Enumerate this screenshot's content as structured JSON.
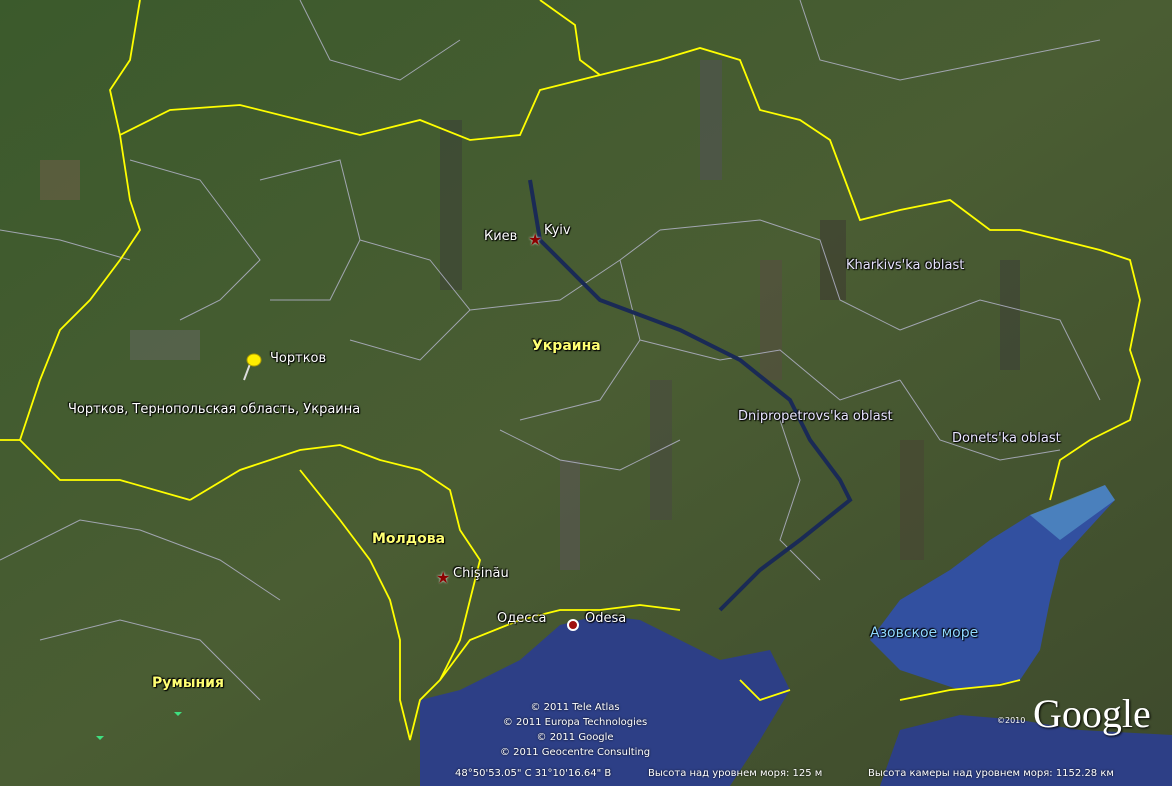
{
  "places": {
    "kyiv_ru": "Киев",
    "kyiv_en": "Kyiv",
    "chortkov": "Чортков",
    "chortkov_full": "Чортков, Тернопольская область, Украина",
    "ukraine": "Украина",
    "kharkiv": "Kharkivs'ka oblast",
    "dnipro": "Dnipropetrovs'ka oblast",
    "donetsk": "Donets'ka oblast",
    "moldova": "Молдова",
    "chisinau": "Chişinău",
    "odessa_ru": "Одесса",
    "odesa_en": "Odesa",
    "azov": "Азовское море",
    "romania": "Румыния"
  },
  "attribution": [
    "© 2011 Tele Atlas",
    "© 2011 Europa Technologies",
    "© 2011 Google",
    "© 2011 Geocentre Consulting"
  ],
  "logo": "Google",
  "logo_copyright": "©2010",
  "status": {
    "coords": "48°50'53.05\" С  31°10'16.64\" В",
    "elevation": "Высота над уровнем моря:  125 м",
    "camera": "Высота камеры над уровнем моря:  1152.28 км"
  },
  "colors": {
    "border": "#ffff00",
    "sea": "#2d3f86",
    "land": "#3a5a2a"
  }
}
